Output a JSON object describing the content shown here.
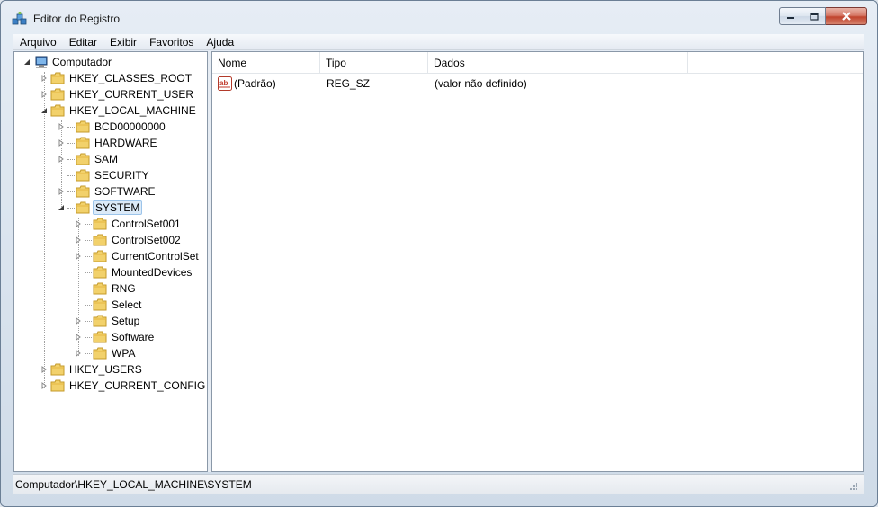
{
  "window": {
    "title": "Editor do Registro",
    "app_icon": "regedit-icon"
  },
  "menu": [
    "Arquivo",
    "Editar",
    "Exibir",
    "Favoritos",
    "Ajuda"
  ],
  "tree": {
    "root": "Computador",
    "hives": {
      "classes_root": "HKEY_CLASSES_ROOT",
      "current_user": "HKEY_CURRENT_USER",
      "local_machine": "HKEY_LOCAL_MACHINE",
      "users": "HKEY_USERS",
      "current_config": "HKEY_CURRENT_CONFIG"
    },
    "local_machine_children": [
      "BCD00000000",
      "HARDWARE",
      "SAM",
      "SECURITY",
      "SOFTWARE",
      "SYSTEM"
    ],
    "system_children": [
      "ControlSet001",
      "ControlSet002",
      "CurrentControlSet",
      "MountedDevices",
      "RNG",
      "Select",
      "Setup",
      "Software",
      "WPA"
    ],
    "selected": "SYSTEM"
  },
  "values": {
    "columns": [
      "Nome",
      "Tipo",
      "Dados"
    ],
    "rows": [
      {
        "name": "(Padrão)",
        "type": "REG_SZ",
        "data": "(valor não definido)",
        "icon": "string-value-icon"
      }
    ]
  },
  "status": {
    "path": "Computador\\HKEY_LOCAL_MACHINE\\SYSTEM"
  },
  "colors": {
    "folder": "#f2d16b",
    "selection": "#dbeaf8",
    "close_button": "#c0432d"
  }
}
